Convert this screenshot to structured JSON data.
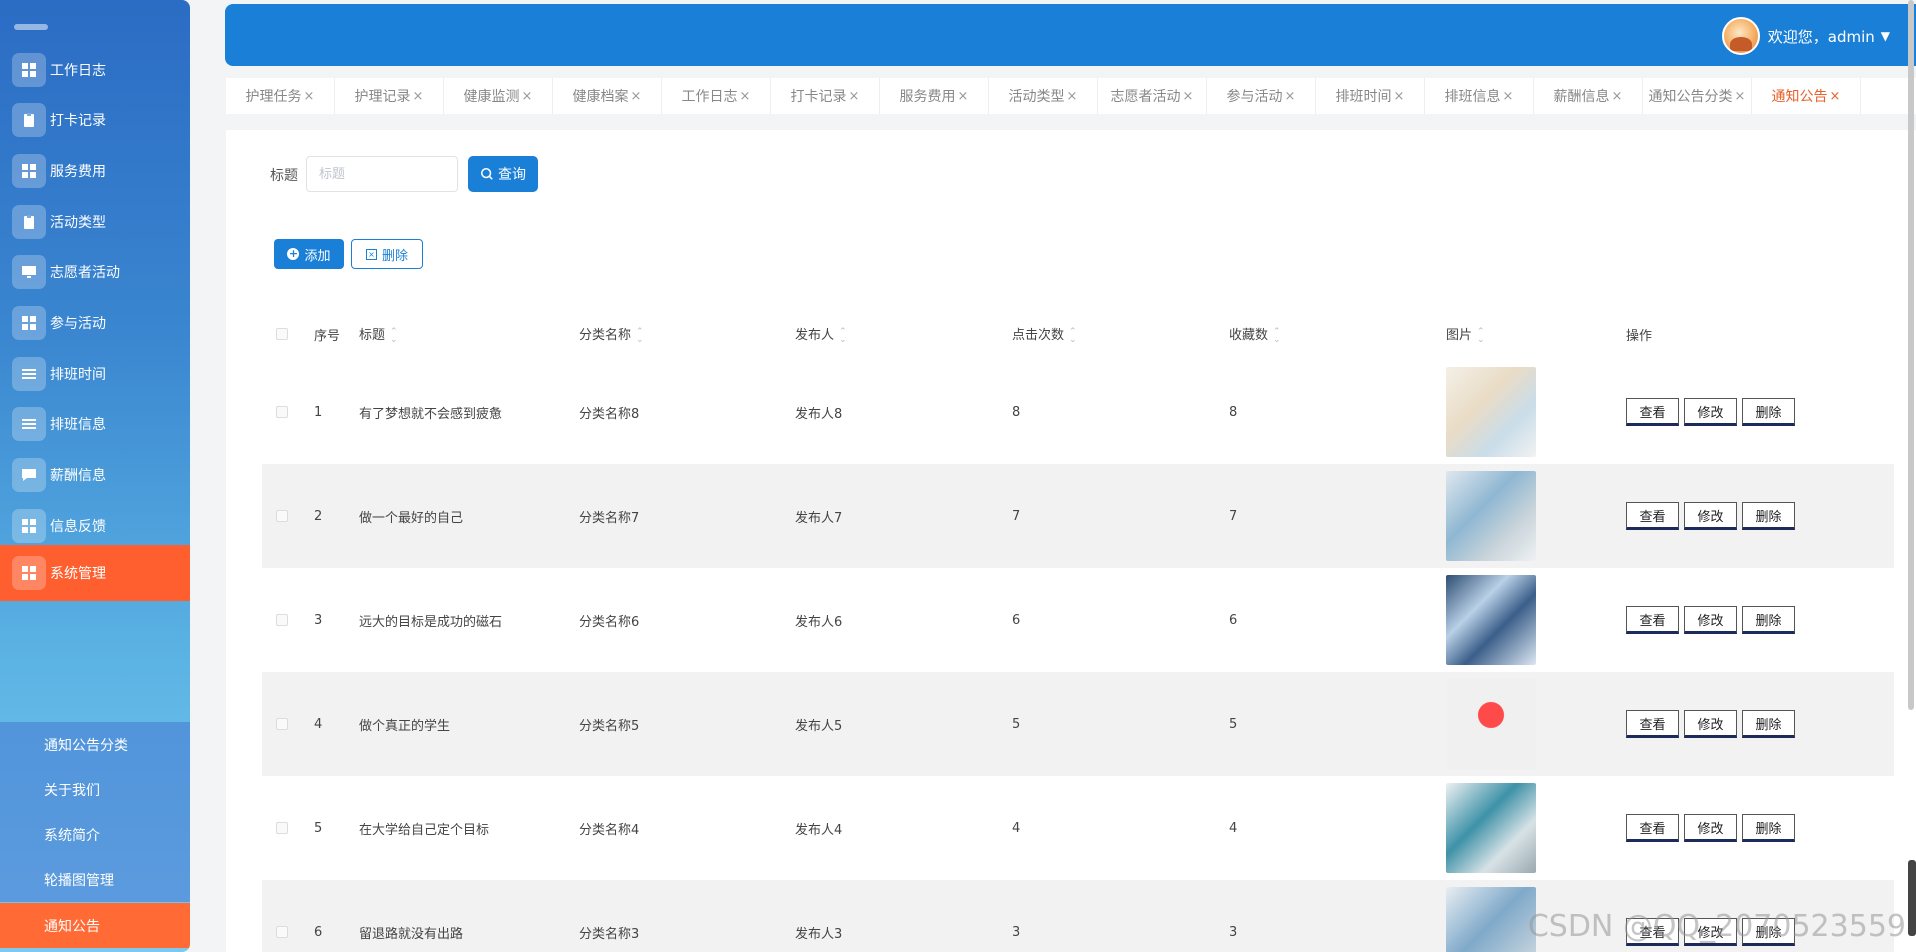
{
  "sidebar": {
    "items": [
      {
        "label": "工作日志",
        "icon": "grid-icon"
      },
      {
        "label": "打卡记录",
        "icon": "clipboard-icon"
      },
      {
        "label": "服务费用",
        "icon": "grid-icon"
      },
      {
        "label": "活动类型",
        "icon": "clipboard-icon"
      },
      {
        "label": "志愿者活动",
        "icon": "monitor-icon"
      },
      {
        "label": "参与活动",
        "icon": "grid-icon"
      },
      {
        "label": "排班时间",
        "icon": "list-icon"
      },
      {
        "label": "排班信息",
        "icon": "list-icon"
      },
      {
        "label": "薪酬信息",
        "icon": "chat-icon"
      },
      {
        "label": "信息反馈",
        "icon": "grid-icon"
      },
      {
        "label": "系统管理",
        "icon": "grid-icon"
      }
    ],
    "sub_items": [
      {
        "label": "通知公告分类"
      },
      {
        "label": "关于我们"
      },
      {
        "label": "系统简介"
      },
      {
        "label": "轮播图管理"
      },
      {
        "label": "通知公告"
      }
    ]
  },
  "header": {
    "welcome": "欢迎您，admin"
  },
  "tabs": [
    "护理任务",
    "护理记录",
    "健康监测",
    "健康档案",
    "工作日志",
    "打卡记录",
    "服务费用",
    "活动类型",
    "志愿者活动",
    "参与活动",
    "排班时间",
    "排班信息",
    "薪酬信息",
    "通知公告分类",
    "通知公告"
  ],
  "tab_close": "×",
  "search": {
    "label": "标题",
    "placeholder": "标题",
    "query_label": "查询"
  },
  "toolbar": {
    "add_label": "添加",
    "delete_label": "删除"
  },
  "table": {
    "headers": {
      "no": "序号",
      "title": "标题",
      "category": "分类名称",
      "publisher": "发布人",
      "clicks": "点击次数",
      "favorites": "收藏数",
      "image": "图片",
      "actions": "操作"
    },
    "rows": [
      {
        "no": "1",
        "title": "有了梦想就不会感到疲惫",
        "category": "分类名称8",
        "publisher": "发布人8",
        "clicks": "8",
        "favorites": "8"
      },
      {
        "no": "2",
        "title": "做一个最好的自己",
        "category": "分类名称7",
        "publisher": "发布人7",
        "clicks": "7",
        "favorites": "7"
      },
      {
        "no": "3",
        "title": "远大的目标是成功的磁石",
        "category": "分类名称6",
        "publisher": "发布人6",
        "clicks": "6",
        "favorites": "6"
      },
      {
        "no": "4",
        "title": "做个真正的学生",
        "category": "分类名称5",
        "publisher": "发布人5",
        "clicks": "5",
        "favorites": "5"
      },
      {
        "no": "5",
        "title": "在大学给自己定个目标",
        "category": "分类名称4",
        "publisher": "发布人4",
        "clicks": "4",
        "favorites": "4"
      },
      {
        "no": "6",
        "title": "留退路就没有出路",
        "category": "分类名称3",
        "publisher": "发布人3",
        "clicks": "3",
        "favorites": "3"
      }
    ],
    "action_labels": {
      "view": "查看",
      "edit": "修改",
      "delete": "删除"
    }
  },
  "watermark": "CSDN @QQ_2070523559",
  "colors": {
    "primary": "#1a7fd6",
    "active_menu": "#ff5e2e",
    "active_tab": "#e8602a"
  }
}
